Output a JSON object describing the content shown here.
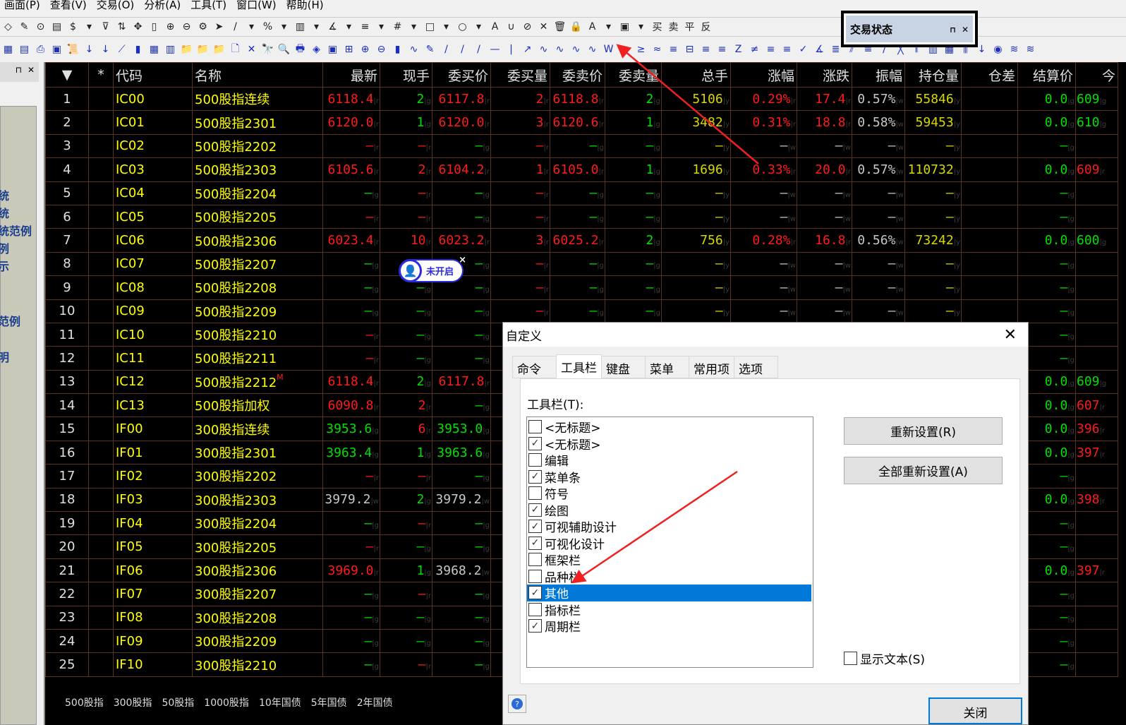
{
  "menu": [
    "画面(P)",
    "查看(V)",
    "交易(O)",
    "分析(A)",
    "工具(T)",
    "窗口(W)",
    "帮助(H)"
  ],
  "toolbar1": [
    "◇",
    "✎",
    "⊙",
    "▤",
    "$",
    "▾",
    "⊽",
    "⇅",
    "✥",
    "▯",
    "⊕",
    "⊖",
    "⚙",
    "➤",
    "/",
    "▾",
    "%",
    "▾",
    "▥",
    "▾",
    "∡",
    "▾",
    "≡",
    "▾",
    "#",
    "▾",
    "□",
    "▾",
    "○",
    "▾",
    "A",
    "∪",
    "⊘",
    "✕",
    "🗑",
    "🔒",
    "A",
    "▾",
    "▣",
    "▾",
    "买",
    "卖",
    "平",
    "反"
  ],
  "toolbar2": [
    "▦",
    "▤",
    "⎙",
    "▣",
    "📜",
    "↓",
    "↓",
    "⟋",
    "▮",
    "▦",
    "▥",
    "📁",
    "📁",
    "📁",
    "🗋",
    "✕",
    "🔭",
    "🔍",
    "🖶",
    "◈",
    "▣",
    "⊞",
    "⊕",
    "⊖",
    "▮",
    "∿",
    "✎",
    "/",
    "/",
    "/",
    "—",
    "|",
    "↗",
    "∿",
    "∿",
    "∿",
    "∿",
    "W",
    "↗",
    "≥",
    "≈",
    "≡",
    "⊟",
    "≡",
    "≡",
    "Z",
    "≠",
    "≡",
    "≡",
    "✓",
    "∡",
    "≣",
    "⫽",
    "≡",
    "∕",
    "╳",
    "𝄃",
    "▥",
    "▦",
    "⫼",
    "↓",
    "◉",
    "≋",
    "≋"
  ],
  "left_panel": {
    "pin": "⊓",
    "close": "✕",
    "items": [
      "统",
      "统",
      "统范例",
      "例",
      "示",
      "范例",
      "明"
    ]
  },
  "trade_panel": {
    "title": "交易状态",
    "pin": "⊓",
    "close": "✕"
  },
  "widget": {
    "label": "未开启",
    "close": "×"
  },
  "table": {
    "headers": [
      "▼",
      "*",
      "代码",
      "名称",
      "最新",
      "现手",
      "委买价",
      "委买量",
      "委卖价",
      "委卖量",
      "总手",
      "涨幅",
      "涨跌",
      "振幅",
      "持仓量",
      "仓差",
      "结算价",
      "今"
    ],
    "colors": {
      "r": "#ff1a1a",
      "g": "#00e000",
      "w": "#c8c8c8",
      "y": "#d8d800"
    },
    "rows": [
      {
        "n": "1",
        "code": "IC00",
        "name": "500股指连续",
        "cells": [
          "6118.4|r",
          "2|g",
          "6117.8|r",
          "2|r",
          "6118.8|r",
          "2|g",
          "5106|y",
          "0.29%|r",
          "17.4|r",
          "0.57%|w",
          "55846|y",
          "",
          "0.0|g",
          "609|g"
        ]
      },
      {
        "n": "2",
        "code": "IC01",
        "name": "500股指2301",
        "cells": [
          "6120.0|r",
          "1|g",
          "6120.0|r",
          "3|r",
          "6120.6|r",
          "1|g",
          "3482|y",
          "0.31%|r",
          "18.8|r",
          "0.58%|w",
          "59453|y",
          "",
          "0.0|g",
          "610|g"
        ]
      },
      {
        "n": "3",
        "code": "IC02",
        "name": "500股指2202",
        "cells": [
          "—|r",
          "—|r",
          "—|g",
          "—|r",
          "—|g",
          "—|g",
          "—|y",
          "—|w",
          "—|w",
          "—|w",
          "—|y",
          "",
          "—|g",
          ""
        ]
      },
      {
        "n": "4",
        "code": "IC03",
        "name": "500股指2303",
        "cells": [
          "6105.6|r",
          "2|r",
          "6104.2|r",
          "1|r",
          "6105.0|r",
          "1|g",
          "1696|y",
          "0.33%|r",
          "20.0|r",
          "0.57%|w",
          "110732|y",
          "",
          "0.0|g",
          "609|r"
        ]
      },
      {
        "n": "5",
        "code": "IC04",
        "name": "500股指2204",
        "cells": [
          "—|g",
          "—|r",
          "—|g",
          "—|r",
          "—|g",
          "—|g",
          "—|y",
          "—|w",
          "—|w",
          "—|w",
          "—|y",
          "",
          "—|g",
          ""
        ]
      },
      {
        "n": "6",
        "code": "IC05",
        "name": "500股指2205",
        "cells": [
          "—|r",
          "—|r",
          "—|g",
          "—|r",
          "—|g",
          "—|g",
          "—|y",
          "—|w",
          "—|w",
          "—|w",
          "—|y",
          "",
          "—|g",
          ""
        ]
      },
      {
        "n": "7",
        "code": "IC06",
        "name": "500股指2306",
        "cells": [
          "6023.4|r",
          "10|r",
          "6023.2|r",
          "3|r",
          "6025.2|r",
          "2|g",
          "756|y",
          "0.28%|r",
          "16.8|r",
          "0.56%|w",
          "73242|y",
          "",
          "0.0|g",
          "600|g"
        ]
      },
      {
        "n": "8",
        "code": "IC07",
        "name": "500股指2207",
        "cells": [
          "—|g",
          "—|g",
          "—|g",
          "—|r",
          "—|g",
          "—|g",
          "—|y",
          "—|w",
          "—|w",
          "—|w",
          "—|y",
          "",
          "—|g",
          ""
        ]
      },
      {
        "n": "9",
        "code": "IC08",
        "name": "500股指2208",
        "cells": [
          "—|g",
          "—|g",
          "—|g",
          "—|r",
          "—|g",
          "—|g",
          "—|y",
          "—|w",
          "—|w",
          "—|w",
          "—|y",
          "",
          "—|g",
          ""
        ]
      },
      {
        "n": "10",
        "code": "IC09",
        "name": "500股指2209",
        "cells": [
          "—|g",
          "—|g",
          "—|g",
          "—|r",
          "—|g",
          "—|g",
          "—|y",
          "—|w",
          "—|w",
          "—|w",
          "—|y",
          "",
          "—|g",
          ""
        ]
      },
      {
        "n": "11",
        "code": "IC10",
        "name": "500股指2210",
        "cells": [
          "—|r",
          "—|g",
          "—|g",
          "",
          "",
          "",
          "",
          "",
          "",
          "",
          "",
          "",
          "—|g",
          ""
        ]
      },
      {
        "n": "12",
        "code": "IC11",
        "name": "500股指2211",
        "cells": [
          "—|r",
          "—|g",
          "—|g",
          "",
          "",
          "",
          "",
          "",
          "",
          "",
          "",
          "",
          "—|g",
          ""
        ]
      },
      {
        "n": "13",
        "code": "IC12",
        "name": "500股指2212",
        "mark": "M",
        "cells": [
          "6118.4|r",
          "2|g",
          "6117.8|r",
          "",
          "",
          "",
          "",
          "",
          "",
          "",
          "",
          "",
          "0.0|g",
          "609|g"
        ]
      },
      {
        "n": "14",
        "code": "IC13",
        "name": "500股指加权",
        "cells": [
          "6090.8|r",
          "2|r",
          "—|g",
          "",
          "",
          "",
          "",
          "",
          "",
          "",
          "",
          "",
          "0.0|g",
          "607|r"
        ]
      },
      {
        "n": "15",
        "code": "IF00",
        "name": "300股指连续",
        "cells": [
          "3953.6|g",
          "6|r",
          "3953.0|g",
          "",
          "",
          "",
          "",
          "",
          "",
          "",
          "",
          "",
          "0.0|g",
          "396|r"
        ]
      },
      {
        "n": "16",
        "code": "IF01",
        "name": "300股指2301",
        "cells": [
          "3963.4|g",
          "1|g",
          "3963.6|g",
          "",
          "",
          "",
          "",
          "",
          "",
          "",
          "",
          "",
          "0.0|g",
          "397|r"
        ]
      },
      {
        "n": "17",
        "code": "IF02",
        "name": "300股指2202",
        "cells": [
          "—|r",
          "—|r",
          "—|g",
          "",
          "",
          "",
          "",
          "",
          "",
          "",
          "",
          "",
          "—|g",
          ""
        ]
      },
      {
        "n": "18",
        "code": "IF03",
        "name": "300股指2303",
        "cells": [
          "3979.2|w",
          "2|g",
          "3979.2|w",
          "",
          "",
          "",
          "",
          "",
          "",
          "",
          "",
          "",
          "0.0|g",
          "398|r"
        ]
      },
      {
        "n": "19",
        "code": "IF04",
        "name": "300股指2204",
        "cells": [
          "—|g",
          "—|r",
          "—|g",
          "",
          "",
          "",
          "",
          "",
          "",
          "",
          "",
          "",
          "—|g",
          ""
        ]
      },
      {
        "n": "20",
        "code": "IF05",
        "name": "300股指2205",
        "cells": [
          "—|r",
          "—|g",
          "—|g",
          "",
          "",
          "",
          "",
          "",
          "",
          "",
          "",
          "",
          "—|g",
          ""
        ]
      },
      {
        "n": "21",
        "code": "IF06",
        "name": "300股指2306",
        "cells": [
          "3969.0|r",
          "1|g",
          "3968.2|w",
          "",
          "",
          "",
          "",
          "",
          "",
          "",
          "",
          "",
          "0.0|g",
          "397|r"
        ]
      },
      {
        "n": "22",
        "code": "IF07",
        "name": "300股指2207",
        "cells": [
          "—|g",
          "—|r",
          "—|g",
          "",
          "",
          "",
          "",
          "",
          "",
          "",
          "",
          "",
          "—|g",
          ""
        ]
      },
      {
        "n": "23",
        "code": "IF08",
        "name": "300股指2208",
        "cells": [
          "—|g",
          "—|g",
          "—|g",
          "",
          "",
          "",
          "",
          "",
          "",
          "",
          "",
          "",
          "—|g",
          ""
        ]
      },
      {
        "n": "24",
        "code": "IF09",
        "name": "300股指2209",
        "cells": [
          "—|g",
          "—|g",
          "—|g",
          "",
          "",
          "",
          "",
          "",
          "",
          "",
          "",
          "",
          "—|g",
          ""
        ]
      },
      {
        "n": "25",
        "code": "IF10",
        "name": "300股指2210",
        "cells": [
          "—|g",
          "—|r",
          "—|g",
          "",
          "",
          "",
          "",
          "",
          "",
          "",
          "",
          "",
          "—|g",
          ""
        ]
      }
    ]
  },
  "bottom_tabs": [
    "500股指",
    "300股指",
    "50股指",
    "1000股指",
    "10年国债",
    "5年国债",
    "2年国债"
  ],
  "dialog": {
    "title": "自定义",
    "close": "✕",
    "tabs": [
      "命令",
      "工具栏",
      "键盘",
      "菜单",
      "常用项",
      "选项"
    ],
    "active_tab": 1,
    "toolbar_label": "工具栏(T):",
    "toolbars": [
      {
        "label": "<无标题>",
        "checked": false
      },
      {
        "label": "<无标题>",
        "checked": true
      },
      {
        "label": "编辑",
        "checked": false
      },
      {
        "label": "菜单条",
        "checked": true
      },
      {
        "label": "符号",
        "checked": false
      },
      {
        "label": "绘图",
        "checked": true
      },
      {
        "label": "可视辅助设计",
        "checked": true
      },
      {
        "label": "可视化设计",
        "checked": true
      },
      {
        "label": "框架栏",
        "checked": false
      },
      {
        "label": "品种栏",
        "checked": false
      },
      {
        "label": "其他",
        "checked": true,
        "selected": true
      },
      {
        "label": "指标栏",
        "checked": false
      },
      {
        "label": "周期栏",
        "checked": true
      }
    ],
    "reset_button": "重新设置(R)",
    "reset_all_button": "全部重新设置(A)",
    "show_text_label": "显示文本(S)",
    "show_text_checked": false,
    "help": "?",
    "close_button": "关闭"
  }
}
